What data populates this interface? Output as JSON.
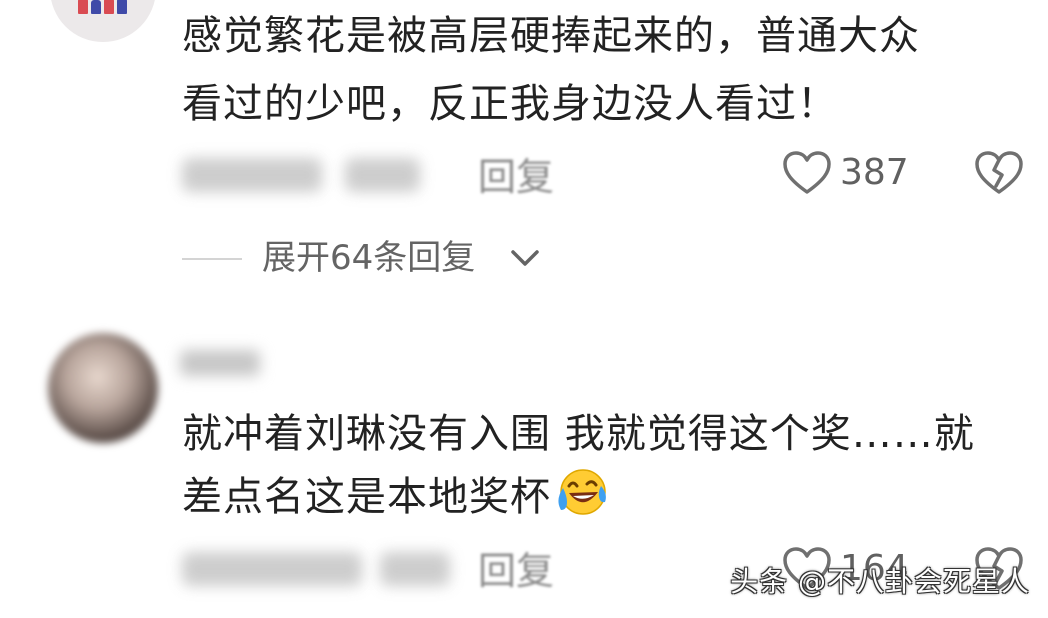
{
  "comments": [
    {
      "line1": "感觉繁花是被高层硬捧起来的，普通大众",
      "line2": "看过的少吧，反正我身边没人看过！",
      "reply_label": "回复",
      "likes": "387"
    },
    {
      "line1": "就冲着刘琳没有入围 我就觉得这个奖……就",
      "line2": "差点名这是本地奖杯",
      "reply_label": "回复",
      "likes": "164"
    }
  ],
  "expand_replies": "展开64条回复",
  "watermark": "头条 @不八卦会死星人",
  "icons": {
    "like": "heart-outline-icon",
    "dislike": "broken-heart-icon",
    "expand": "chevron-down-icon",
    "emoji": "laughing-crying-emoji-icon"
  },
  "colors": {
    "text": "#222222",
    "meta": "#8a8a8a",
    "icon": "#707070"
  }
}
